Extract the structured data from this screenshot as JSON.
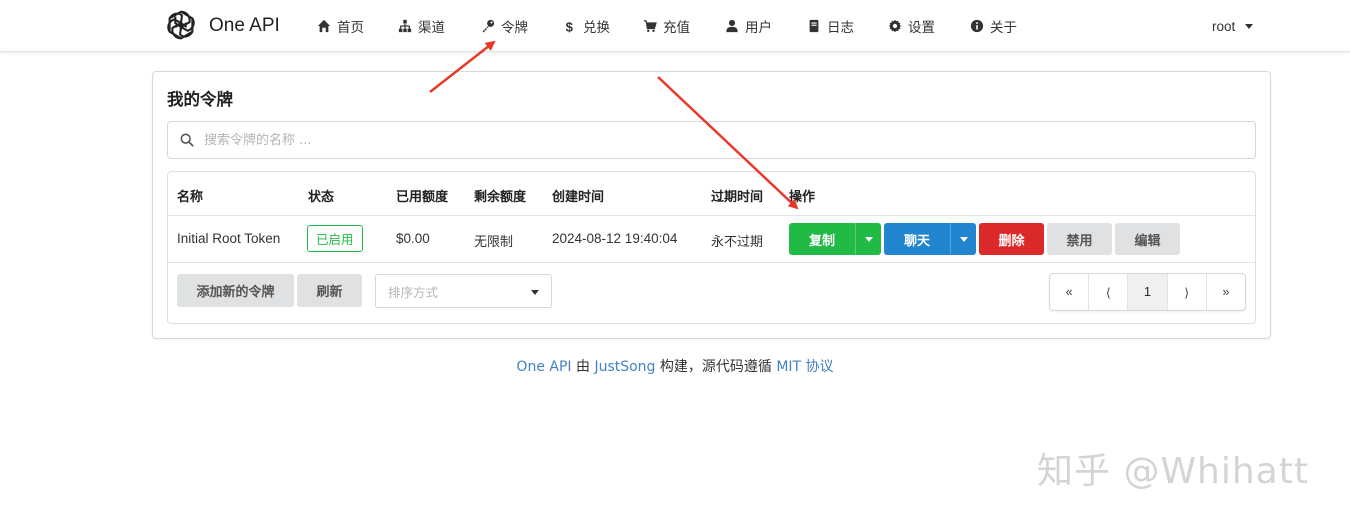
{
  "nav": {
    "brand": "One API",
    "items": [
      {
        "label": "首页",
        "icon": "home-icon"
      },
      {
        "label": "渠道",
        "icon": "sitemap-icon"
      },
      {
        "label": "令牌",
        "icon": "key-icon"
      },
      {
        "label": "兑换",
        "icon": "dollar-icon"
      },
      {
        "label": "充值",
        "icon": "cart-icon"
      },
      {
        "label": "用户",
        "icon": "user-icon"
      },
      {
        "label": "日志",
        "icon": "book-icon"
      },
      {
        "label": "设置",
        "icon": "gear-icon"
      },
      {
        "label": "关于",
        "icon": "info-icon"
      }
    ],
    "user": "root"
  },
  "page": {
    "title": "我的令牌",
    "search_placeholder": "搜索令牌的名称 ..."
  },
  "table": {
    "columns": [
      "名称",
      "状态",
      "已用额度",
      "剩余额度",
      "创建时间",
      "过期时间",
      "操作"
    ],
    "rows": [
      {
        "name": "Initial Root Token",
        "status": "已启用",
        "used": "$0.00",
        "remaining": "无限制",
        "created": "2024-08-12 19:40:04",
        "expires": "永不过期"
      }
    ],
    "actions": {
      "copy": "复制",
      "chat": "聊天",
      "delete": "删除",
      "disable": "禁用",
      "edit": "编辑"
    }
  },
  "toolbar": {
    "add": "添加新的令牌",
    "refresh": "刷新",
    "sort_placeholder": "排序方式"
  },
  "pagination": {
    "first": "«",
    "prev": "⟨",
    "current": "1",
    "next": "⟩",
    "last": "»"
  },
  "footer": {
    "name": "One API",
    "by": " 由 ",
    "author": "JustSong",
    "middle": " 构建，源代码遵循 ",
    "license": "MIT 协议"
  },
  "watermark": "知乎 @Whihatt",
  "colors": {
    "green": "#21ba45",
    "blue": "#2185d0",
    "red": "#db2828",
    "grey": "#e0e1e2",
    "link": "#4183c4",
    "arrow": "#e8392a"
  }
}
